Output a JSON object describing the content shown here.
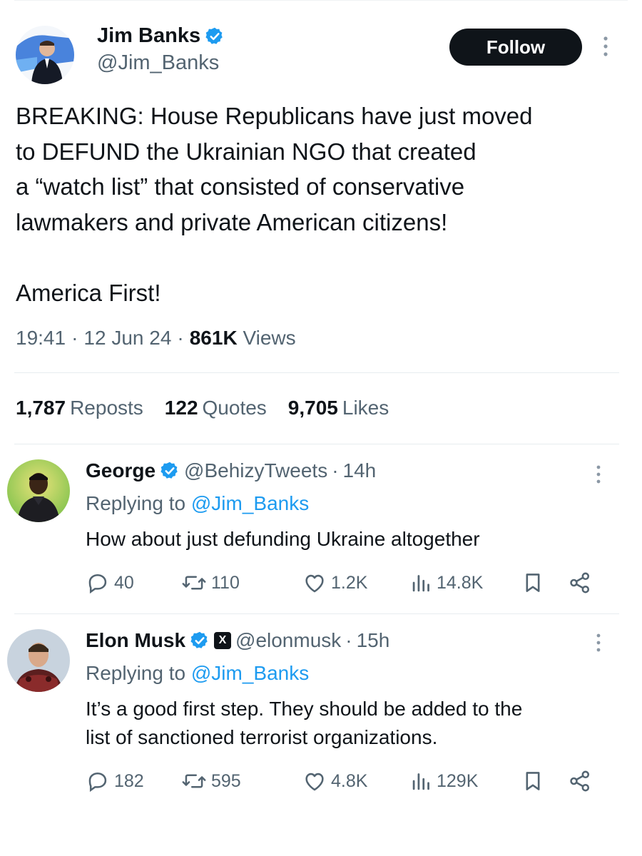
{
  "main_tweet": {
    "author_name": "Jim Banks",
    "author_handle": "@Jim_Banks",
    "follow_label": "Follow",
    "text": "BREAKING: House Republicans have just moved\nto DEFUND the Ukrainian NGO that created\na “watch list” that consisted of conservative\nlawmakers and private American citizens!\n\nAmerica First!",
    "time": "19:41",
    "date": "12 Jun 24",
    "views_count": "861K",
    "views_label": "Views",
    "reposts_count": "1,787",
    "reposts_label": "Reposts",
    "quotes_count": "122",
    "quotes_label": "Quotes",
    "likes_count": "9,705",
    "likes_label": "Likes"
  },
  "replies": [
    {
      "author_name": "George",
      "author_handle": "@BehizyTweets",
      "age": "14h",
      "replying_prefix": "Replying to",
      "replying_to": "@Jim_Banks",
      "text": "How about just defunding Ukraine altogether",
      "replies": "40",
      "reposts": "110",
      "likes": "1.2K",
      "views": "14.8K"
    },
    {
      "author_name": "Elon Musk",
      "author_handle": "@elonmusk",
      "age": "15h",
      "affiliate_badge": "X",
      "replying_prefix": "Replying to",
      "replying_to": "@Jim_Banks",
      "text": "It’s a good first step. They should be added to the\nlist of sanctioned terrorist organizations.",
      "replies": "182",
      "reposts": "595",
      "likes": "4.8K",
      "views": "129K"
    }
  ],
  "separator": "·",
  "colors": {
    "verified": "#1d9bf0",
    "link": "#1d9bf0",
    "secondary_text": "#536471",
    "primary_text": "#0f1419"
  },
  "icons": [
    "verified-icon",
    "more-icon",
    "reply-icon",
    "repost-icon",
    "like-icon",
    "views-icon",
    "bookmark-icon",
    "share-icon"
  ]
}
